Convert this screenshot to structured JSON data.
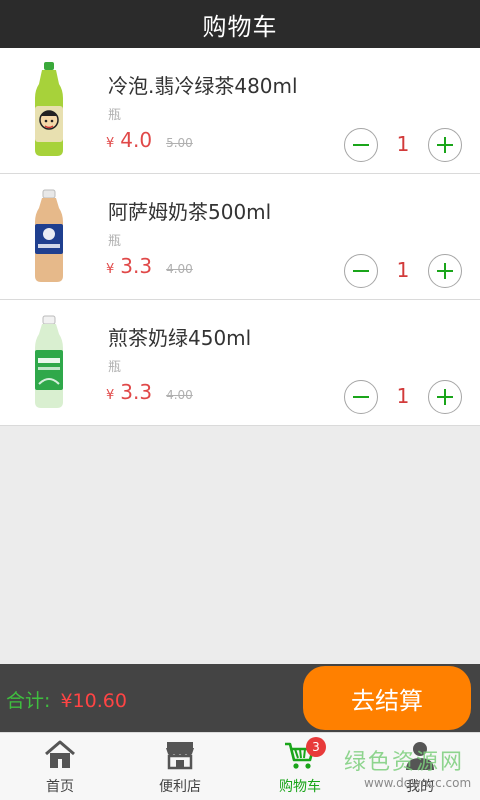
{
  "header": {
    "title": "购物车"
  },
  "cart": {
    "items": [
      {
        "name": "冷泡.翡冷绿茶480ml",
        "unit": "瓶",
        "currency": "¥",
        "price": "4.0",
        "original_price": "5.00",
        "quantity": "1",
        "image": "bottled-green-tea-icon"
      },
      {
        "name": "阿萨姆奶茶500ml",
        "unit": "瓶",
        "currency": "¥",
        "price": "3.3",
        "original_price": "4.00",
        "quantity": "1",
        "image": "bottled-milk-tea-icon"
      },
      {
        "name": "煎茶奶绿450ml",
        "unit": "瓶",
        "currency": "¥",
        "price": "3.3",
        "original_price": "4.00",
        "quantity": "1",
        "image": "bottled-green-milk-tea-icon"
      }
    ]
  },
  "footer": {
    "total_label": "合计:",
    "total_value": "¥10.60",
    "checkout_label": "去结算"
  },
  "tabbar": {
    "tabs": [
      {
        "label": "首页",
        "icon": "home-icon"
      },
      {
        "label": "便利店",
        "icon": "store-icon"
      },
      {
        "label": "购物车",
        "icon": "cart-icon",
        "badge": "3",
        "active": true
      },
      {
        "label": "我的",
        "icon": "user-icon"
      }
    ]
  },
  "watermark": {
    "text": "绿色资源网",
    "url": "www.downcc.com"
  },
  "colors": {
    "header_bg": "#2b2b2b",
    "price_red": "#e04848",
    "checkout_orange": "#ff8000",
    "active_green": "#1aa51a",
    "total_green": "#3fbf3f"
  }
}
